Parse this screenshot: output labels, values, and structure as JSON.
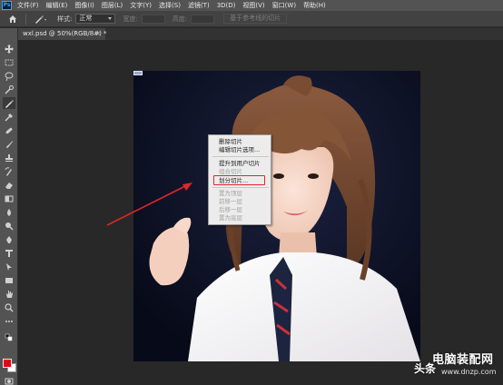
{
  "app": {
    "logo_text": "Ps"
  },
  "menu": [
    "文件(F)",
    "编辑(E)",
    "图像(I)",
    "图层(L)",
    "文字(Y)",
    "选择(S)",
    "滤镜(T)",
    "3D(D)",
    "视图(V)",
    "窗口(W)",
    "帮助(H)"
  ],
  "options": {
    "style_label": "样式:",
    "style_value": "正常",
    "width_label": "宽度:",
    "height_label": "高度:",
    "guides_button": "基于参考线的切片"
  },
  "document_tab": {
    "title": "wxl.psd @ 50%(RGB/8#) *",
    "close": "×"
  },
  "context_menu": {
    "items": [
      {
        "label": "删除切片",
        "enabled": true
      },
      {
        "label": "编辑切片选项...",
        "enabled": true
      },
      {
        "label": "提升到用户切片",
        "enabled": true
      },
      {
        "label": "组合切片",
        "enabled": false
      },
      {
        "label": "划分切片...",
        "enabled": true
      },
      {
        "label": "置为顶层",
        "enabled": false
      },
      {
        "label": "前移一层",
        "enabled": false
      },
      {
        "label": "后移一层",
        "enabled": false
      },
      {
        "label": "置为底层",
        "enabled": false
      }
    ],
    "highlight_color": "#e0262b"
  },
  "colors": {
    "foreground": "#e60012",
    "background": "#ffffff",
    "arrow": "#e0262b"
  },
  "watermark": {
    "source": "头条",
    "site_name": "电脑装配网",
    "url": "www.dnzp.com"
  },
  "tools": [
    "move-icon",
    "marquee-icon",
    "lasso-icon",
    "quick-select-icon",
    "slice-icon",
    "eyedropper-icon",
    "healing-icon",
    "brush-icon",
    "stamp-icon",
    "history-brush-icon",
    "eraser-icon",
    "gradient-icon",
    "blur-icon",
    "dodge-icon",
    "pen-icon",
    "type-icon",
    "path-select-icon",
    "shape-icon",
    "hand-icon",
    "zoom-icon",
    "more-icon"
  ]
}
